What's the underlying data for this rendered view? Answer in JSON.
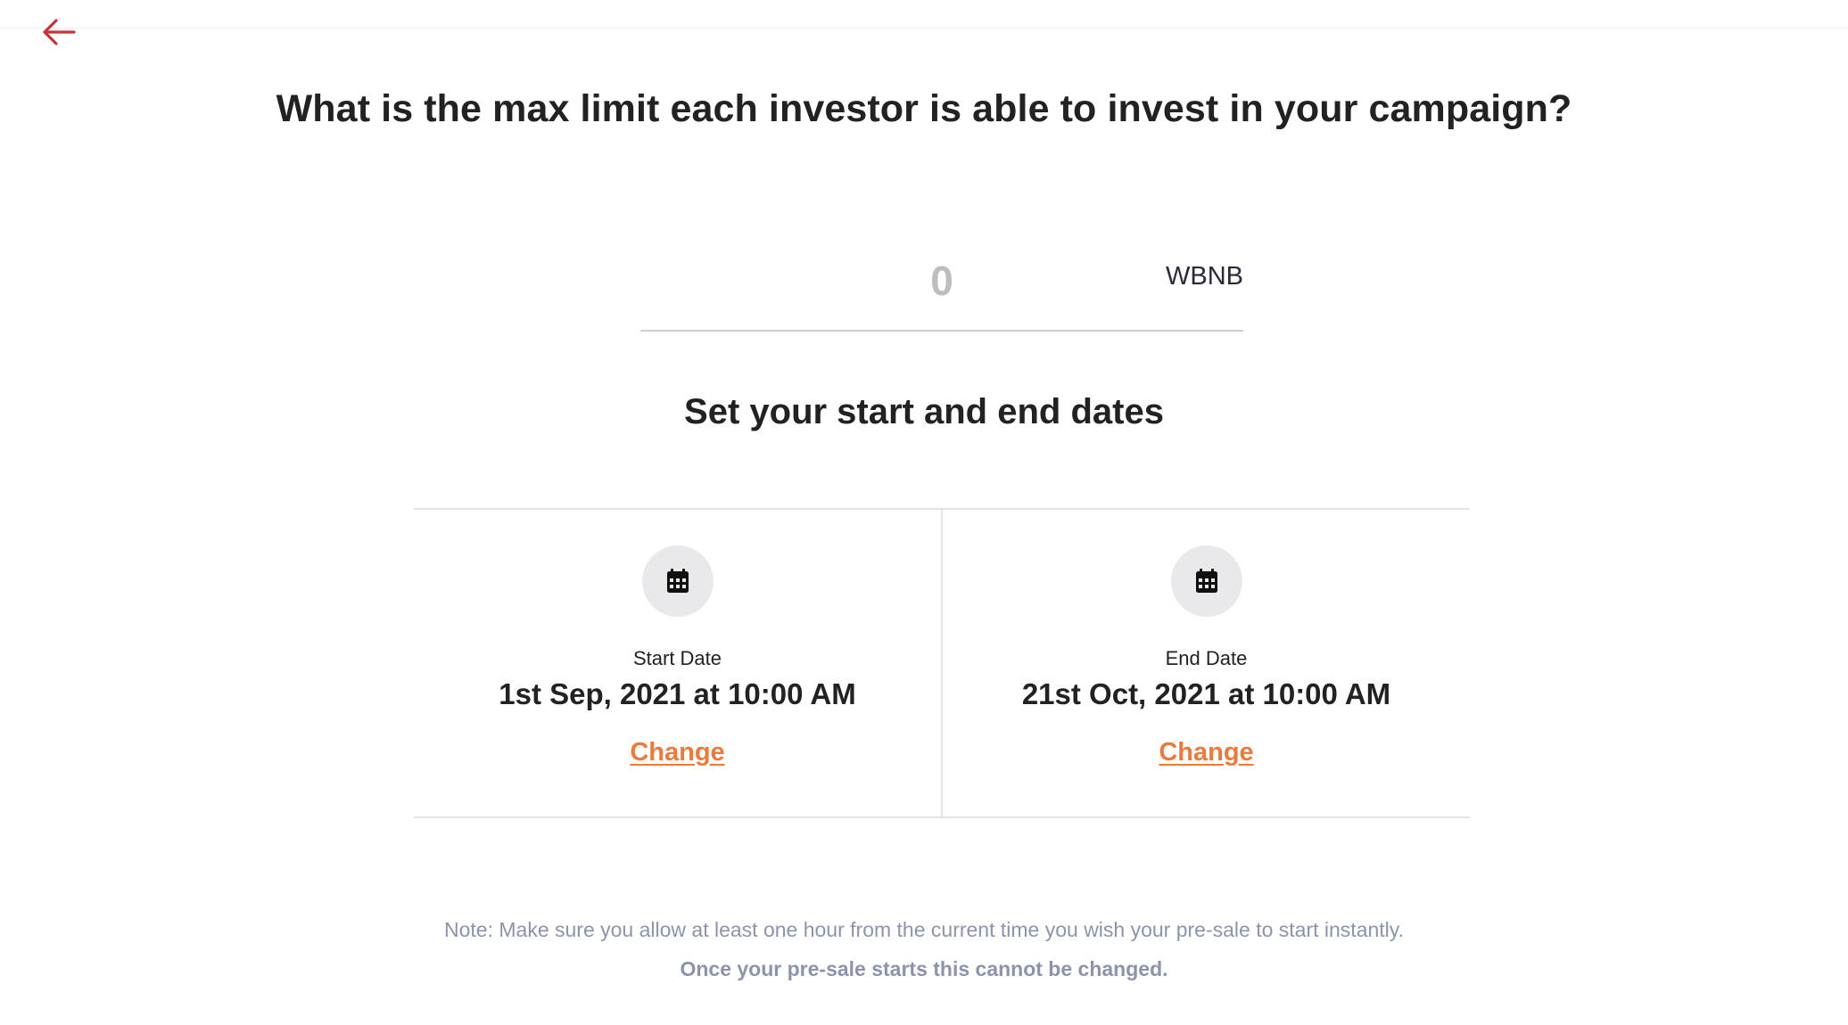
{
  "navigation": {
    "back_icon": "arrow-left-icon",
    "back_color": "#c8333a"
  },
  "max_limit": {
    "question": "What is the max limit each investor is able to invest in your campaign?",
    "amount_value": "",
    "amount_placeholder": "0",
    "currency": "WBNB"
  },
  "dates": {
    "heading": "Set your start and end dates",
    "start": {
      "icon": "calendar-icon",
      "label": "Start Date",
      "value": "1st Sep, 2021 at 10:00 AM",
      "change_label": "Change"
    },
    "end": {
      "icon": "calendar-icon",
      "label": "End Date",
      "value": "21st Oct, 2021 at 10:00 AM",
      "change_label": "Change"
    }
  },
  "notes": {
    "hint": "Note: Make sure you allow at least one hour from the current time you wish your pre-sale to start instantly.",
    "warning": "Once your pre-sale starts this cannot be changed."
  },
  "colors": {
    "accent": "#ea7b3c",
    "muted_text": "#8d93ab"
  }
}
